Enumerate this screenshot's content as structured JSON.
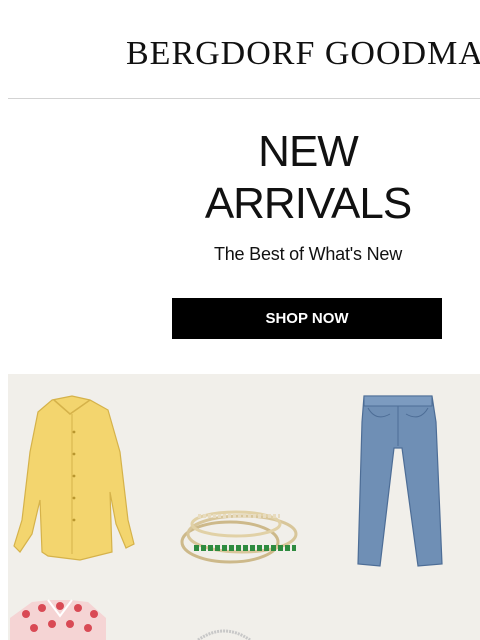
{
  "header": {
    "brand": "BERGDORF GOODMAN"
  },
  "hero": {
    "headline_line1": "NEW",
    "headline_line2": "ARRIVALS",
    "subheadline": "The Best of What's New",
    "cta_label": "SHOP NOW"
  },
  "products": [
    {
      "item": "yellow-button-shirt",
      "color": "#f3d56e"
    },
    {
      "item": "stacked-rings",
      "color": "#2e8b3f"
    },
    {
      "item": "blue-jeans",
      "color": "#6f8fb5"
    },
    {
      "item": "red-print-top",
      "color": "#d94a55"
    },
    {
      "item": "silver-bracelet",
      "color": "#c8c8c8"
    }
  ]
}
